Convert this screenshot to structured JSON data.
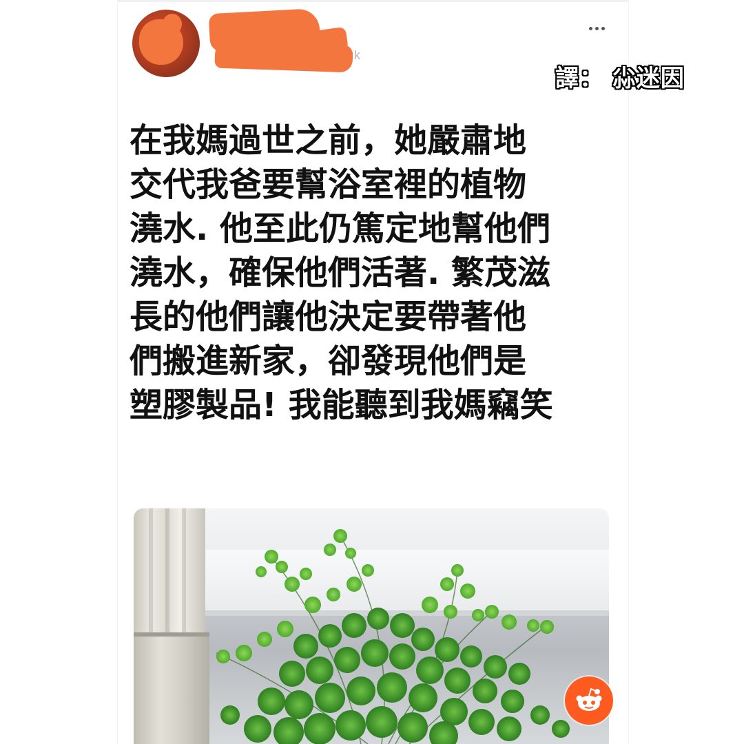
{
  "post": {
    "author": {
      "handle_visible_tail": "k"
    },
    "credit": "譯：  尛迷因",
    "text_lines": [
      "在我媽過世之前，她嚴肅地",
      "交代我爸要幫浴室裡的植物",
      "澆水. 他至此仍篤定地幫他們",
      "澆水，確保他們活著. 繁茂滋",
      "長的他們讓他決定要帶著他",
      "們搬進新家，卻發現他們是",
      "塑膠製品! 我能聽到我媽竊笑"
    ],
    "image": {
      "subject": "maidenhair fern plant on shelf"
    }
  },
  "icons": {
    "more": "more-horizontal-icon",
    "reddit": "reddit-logo-icon"
  },
  "colors": {
    "redaction": "#f4763f",
    "reddit_orange": "#ff5a1f",
    "text": "#111111"
  }
}
